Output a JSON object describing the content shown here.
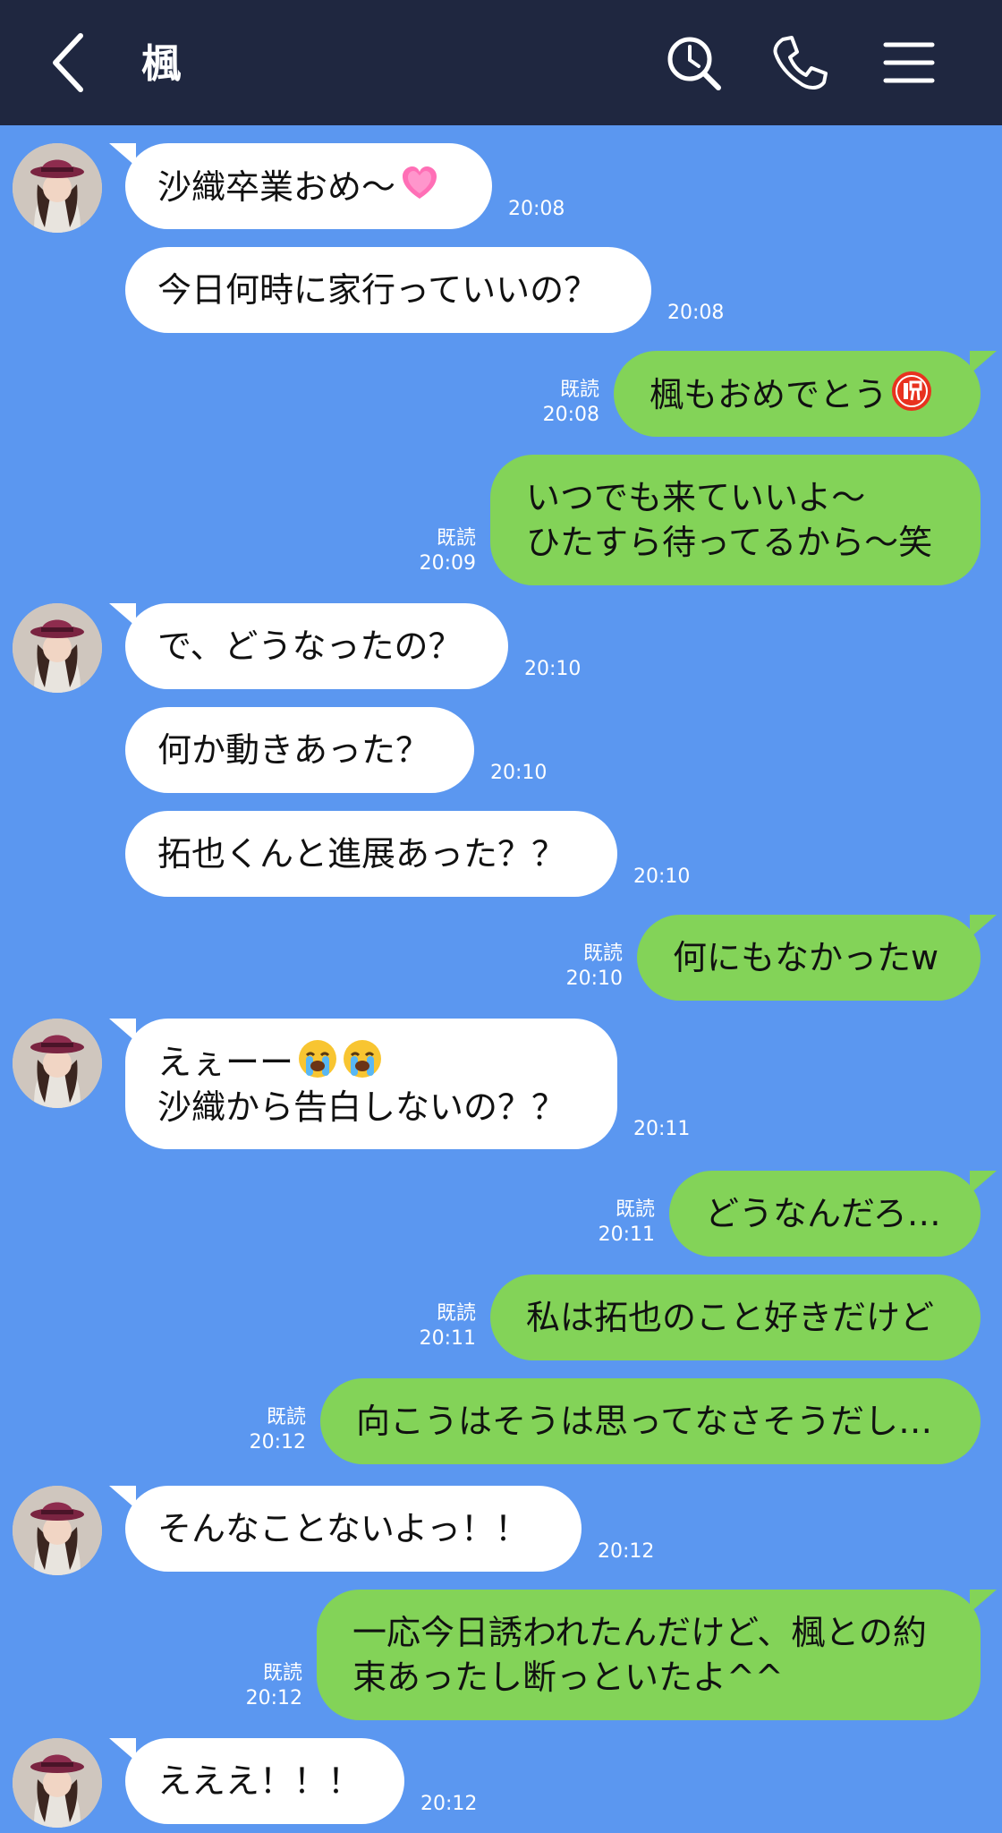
{
  "header": {
    "title": "楓",
    "back_icon": "chevron-left-icon",
    "search_icon": "search-icon",
    "call_icon": "phone-icon",
    "menu_icon": "menu-icon"
  },
  "colors": {
    "header_bg": "#1f2740",
    "chat_bg": "#5b97f0",
    "incoming_bubble": "#ffffff",
    "outgoing_bubble": "#83d358"
  },
  "messages": [
    {
      "dir": "in",
      "lines": [
        "沙織卒業おめ〜"
      ],
      "emoji": "heart",
      "time": "20:08"
    },
    {
      "dir": "in",
      "lines": [
        "今日何時に家行っていいの？"
      ],
      "time": "20:08"
    },
    {
      "dir": "out",
      "lines": [
        "楓もおめでとう"
      ],
      "emoji": "celebration-badge",
      "read": "既読",
      "time": "20:08"
    },
    {
      "dir": "out",
      "lines": [
        "いつでも来ていいよ〜",
        "ひたすら待ってるから〜笑"
      ],
      "read": "既読",
      "time": "20:09"
    },
    {
      "dir": "in",
      "lines": [
        "で、どうなったの？"
      ],
      "time": "20:10"
    },
    {
      "dir": "in",
      "lines": [
        "何か動きあった？"
      ],
      "time": "20:10"
    },
    {
      "dir": "in",
      "lines": [
        "拓也くんと進展あった？？"
      ],
      "time": "20:10"
    },
    {
      "dir": "out",
      "lines": [
        "何にもなかったw"
      ],
      "read": "既読",
      "time": "20:10"
    },
    {
      "dir": "in",
      "lines": [
        "えぇーー",
        "沙織から告白しないの？？"
      ],
      "emoji": "crying-face",
      "time": "20:11"
    },
    {
      "dir": "out",
      "lines": [
        "どうなんだろ…"
      ],
      "read": "既読",
      "time": "20:11"
    },
    {
      "dir": "out",
      "lines": [
        "私は拓也のこと好きだけど"
      ],
      "read": "既読",
      "time": "20:11"
    },
    {
      "dir": "out",
      "lines": [
        "向こうはそうは思ってなさそうだし…"
      ],
      "read": "既読",
      "time": "20:12"
    },
    {
      "dir": "in",
      "lines": [
        "そんなことないよっ！！"
      ],
      "time": "20:12"
    },
    {
      "dir": "out",
      "lines": [
        "一応今日誘われたんだけど、楓との約",
        "束あったし断っといたよ^^"
      ],
      "read": "既読",
      "time": "20:12"
    },
    {
      "dir": "in",
      "lines": [
        "えええ！！！"
      ],
      "time": "20:12"
    }
  ]
}
